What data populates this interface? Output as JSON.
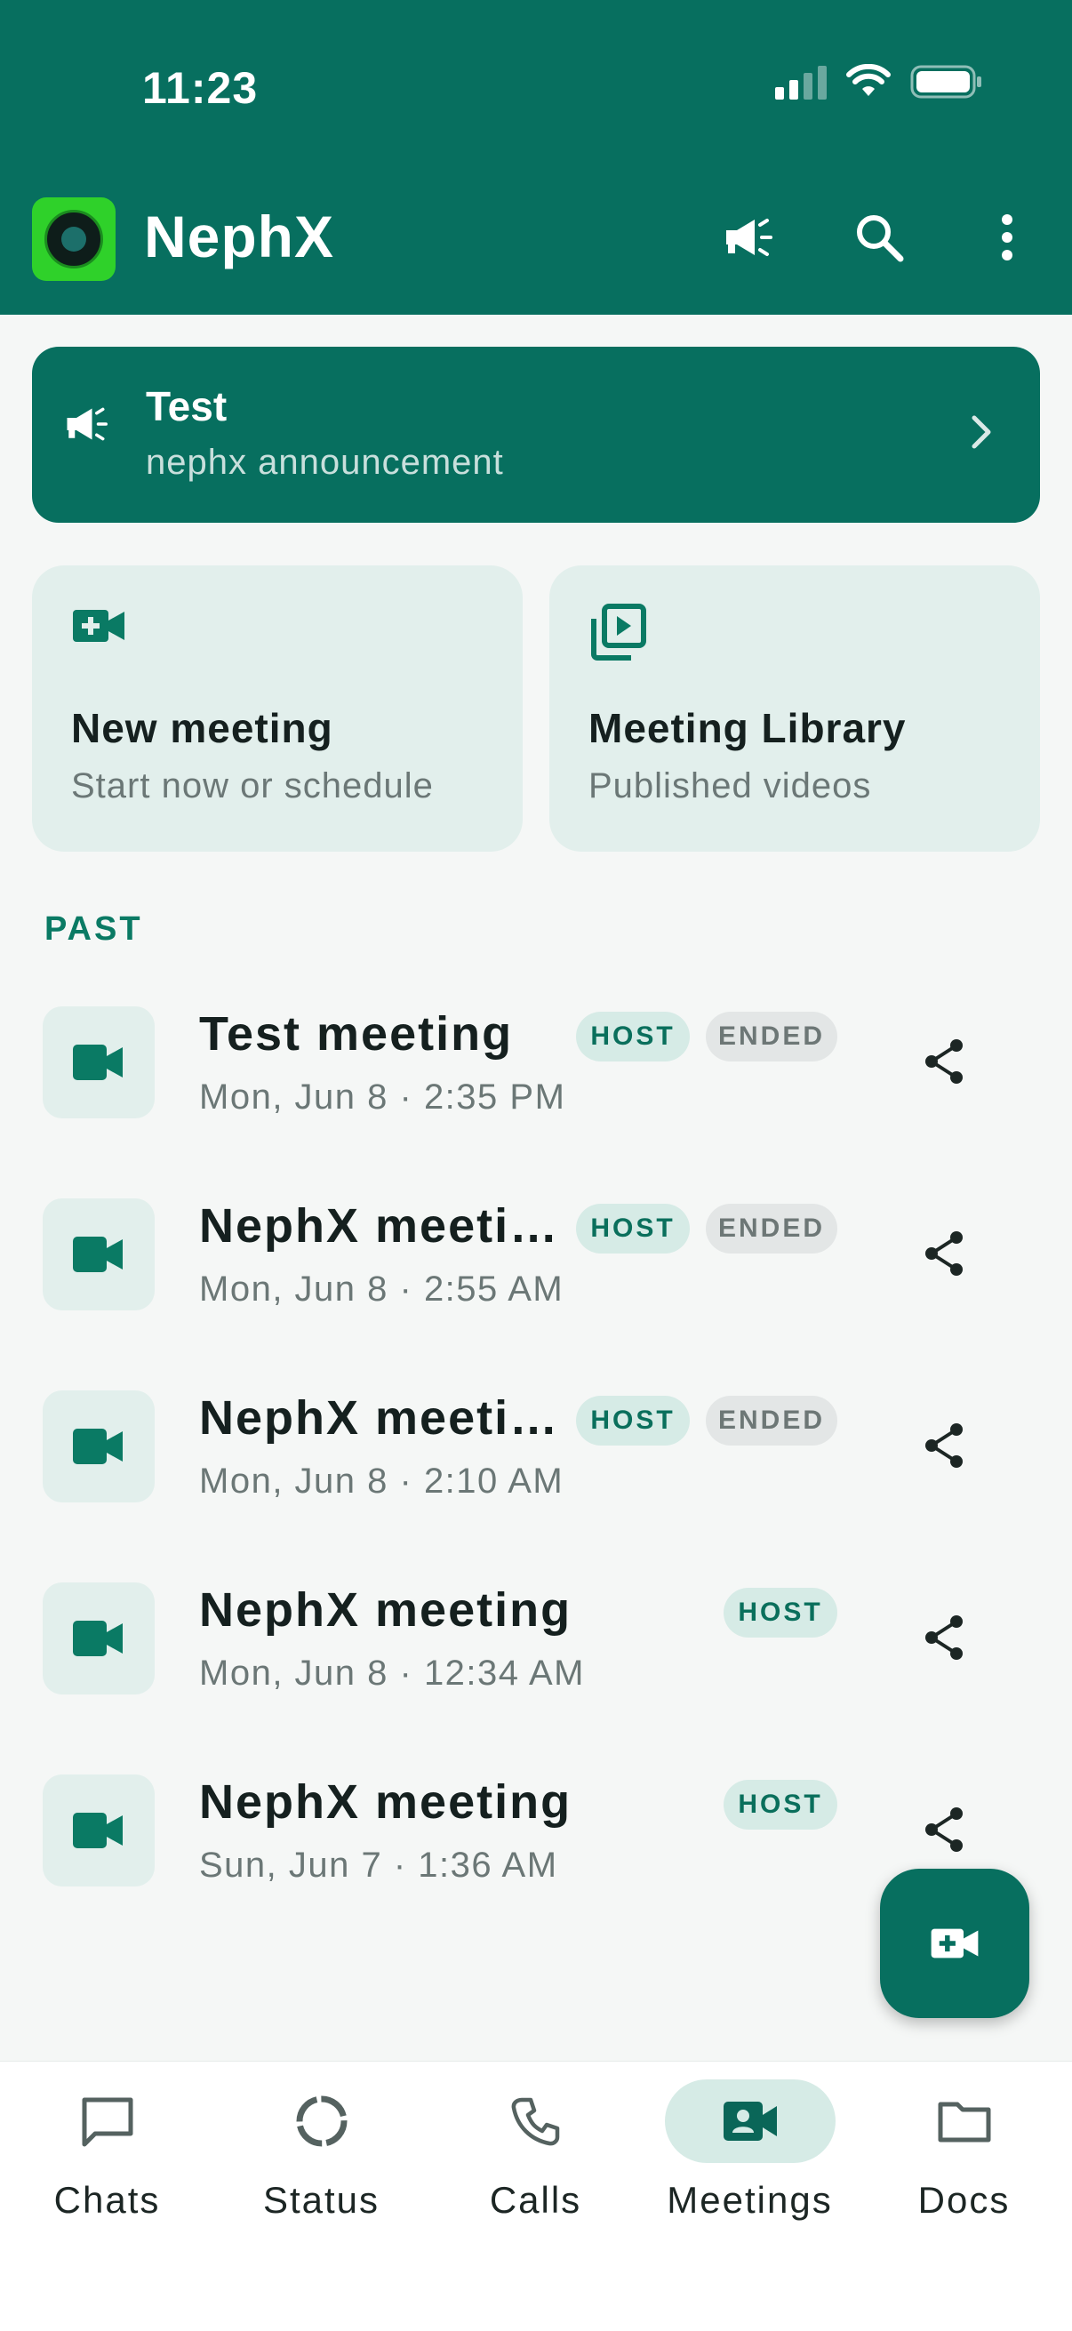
{
  "status_bar": {
    "time": "11:23"
  },
  "app": {
    "title": "NephX",
    "logo": "nephx-logo"
  },
  "header_icons": [
    "megaphone-icon",
    "search-icon",
    "more-vert-icon"
  ],
  "announcement": {
    "title": "Test",
    "subtitle": "nephx announcement"
  },
  "cards": [
    {
      "title": "New meeting",
      "subtitle": "Start now or schedule",
      "icon": "video-add-icon"
    },
    {
      "title": "Meeting Library",
      "subtitle": "Published videos",
      "icon": "video-library-icon"
    }
  ],
  "section": {
    "label": "PAST"
  },
  "meetings": [
    {
      "title": "Test meeting",
      "time": "Mon, Jun 8 · 2:35 PM",
      "host": "HOST",
      "ended": "ENDED"
    },
    {
      "title": "NephX meeti…",
      "time": "Mon, Jun 8 · 2:55 AM",
      "host": "HOST",
      "ended": "ENDED"
    },
    {
      "title": "NephX meeti…",
      "time": "Mon, Jun 8 · 2:10 AM",
      "host": "HOST",
      "ended": "ENDED"
    },
    {
      "title": "NephX meeting",
      "time": "Mon, Jun 8 · 12:34 AM",
      "host": "HOST"
    },
    {
      "title": "NephX meeting",
      "time": "Sun, Jun 7 · 1:36 AM",
      "host": "HOST"
    }
  ],
  "nav": [
    {
      "label": "Chats",
      "icon": "chat-icon"
    },
    {
      "label": "Status",
      "icon": "status-icon"
    },
    {
      "label": "Calls",
      "icon": "phone-icon"
    },
    {
      "label": "Meetings",
      "icon": "meetings-icon",
      "active": true
    },
    {
      "label": "Docs",
      "icon": "folder-icon"
    }
  ],
  "colors": {
    "primary": "#076f5f",
    "tint": "#e2efec",
    "badge_host": "#d6ebe6",
    "badge_ended": "#e3e6e6"
  }
}
